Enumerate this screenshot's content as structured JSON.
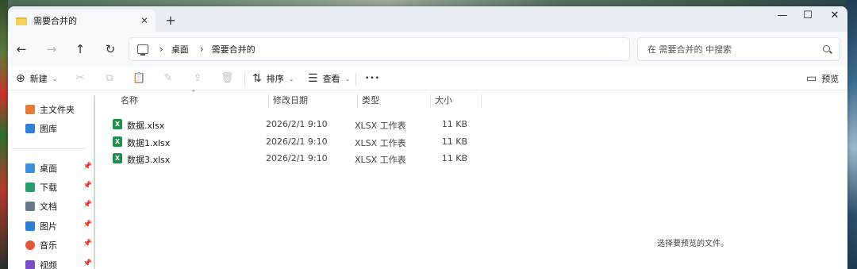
{
  "window": {
    "tab_title": "需要合并的",
    "close_tab_glyph": "✕",
    "new_tab_glyph": "+",
    "controls": {
      "minimize": "—",
      "maximize": "☐",
      "close": "✕"
    }
  },
  "nav": {
    "back_glyph": "←",
    "forward_glyph": "→",
    "up_glyph": "↑",
    "refresh_glyph": "↻"
  },
  "address": {
    "separator": "›",
    "breadcrumbs": [
      "桌面",
      "需要合并的"
    ]
  },
  "search": {
    "placeholder": "在 需要合并的 中搜索"
  },
  "toolbar": {
    "new_label": "新建",
    "sort_label": "排序",
    "view_label": "查看",
    "more_glyph": "•••",
    "preview_label": "预览",
    "caret": "⌄",
    "icons": [
      "cut-icon",
      "copy-icon",
      "paste-icon",
      "rename-icon",
      "share-icon",
      "delete-icon"
    ]
  },
  "sidebar": {
    "top_items": [
      {
        "label": "主文件夹",
        "icon": "home-icon",
        "color": "#e07b3c"
      },
      {
        "label": "图库",
        "icon": "gallery-icon",
        "color": "#2d7fd6"
      }
    ],
    "pinned_items": [
      {
        "label": "桌面",
        "icon": "desktop-icon",
        "color": "#3a8fd8"
      },
      {
        "label": "下载",
        "icon": "download-icon",
        "color": "#2a9d6a"
      },
      {
        "label": "文档",
        "icon": "documents-icon",
        "color": "#6a7a8c"
      },
      {
        "label": "图片",
        "icon": "pictures-icon",
        "color": "#2d7fd6"
      },
      {
        "label": "音乐",
        "icon": "music-icon",
        "color": "#e2573c"
      },
      {
        "label": "视频",
        "icon": "videos-icon",
        "color": "#7b4fc9"
      }
    ],
    "pin_glyph": "📌"
  },
  "files": {
    "columns": [
      "名称",
      "修改日期",
      "类型",
      "大小"
    ],
    "rows": [
      {
        "name": "数据.xlsx",
        "date": "2026/2/1 9:10",
        "type": "XLSX 工作表",
        "size": "11 KB"
      },
      {
        "name": "数据1.xlsx",
        "date": "2026/2/1 9:10",
        "type": "XLSX 工作表",
        "size": "11 KB"
      },
      {
        "name": "数据3.xlsx",
        "date": "2026/2/1 9:10",
        "type": "XLSX 工作表",
        "size": "11 KB"
      }
    ],
    "excel_badge": "X"
  },
  "preview": {
    "message": "选择要预览的文件。"
  }
}
